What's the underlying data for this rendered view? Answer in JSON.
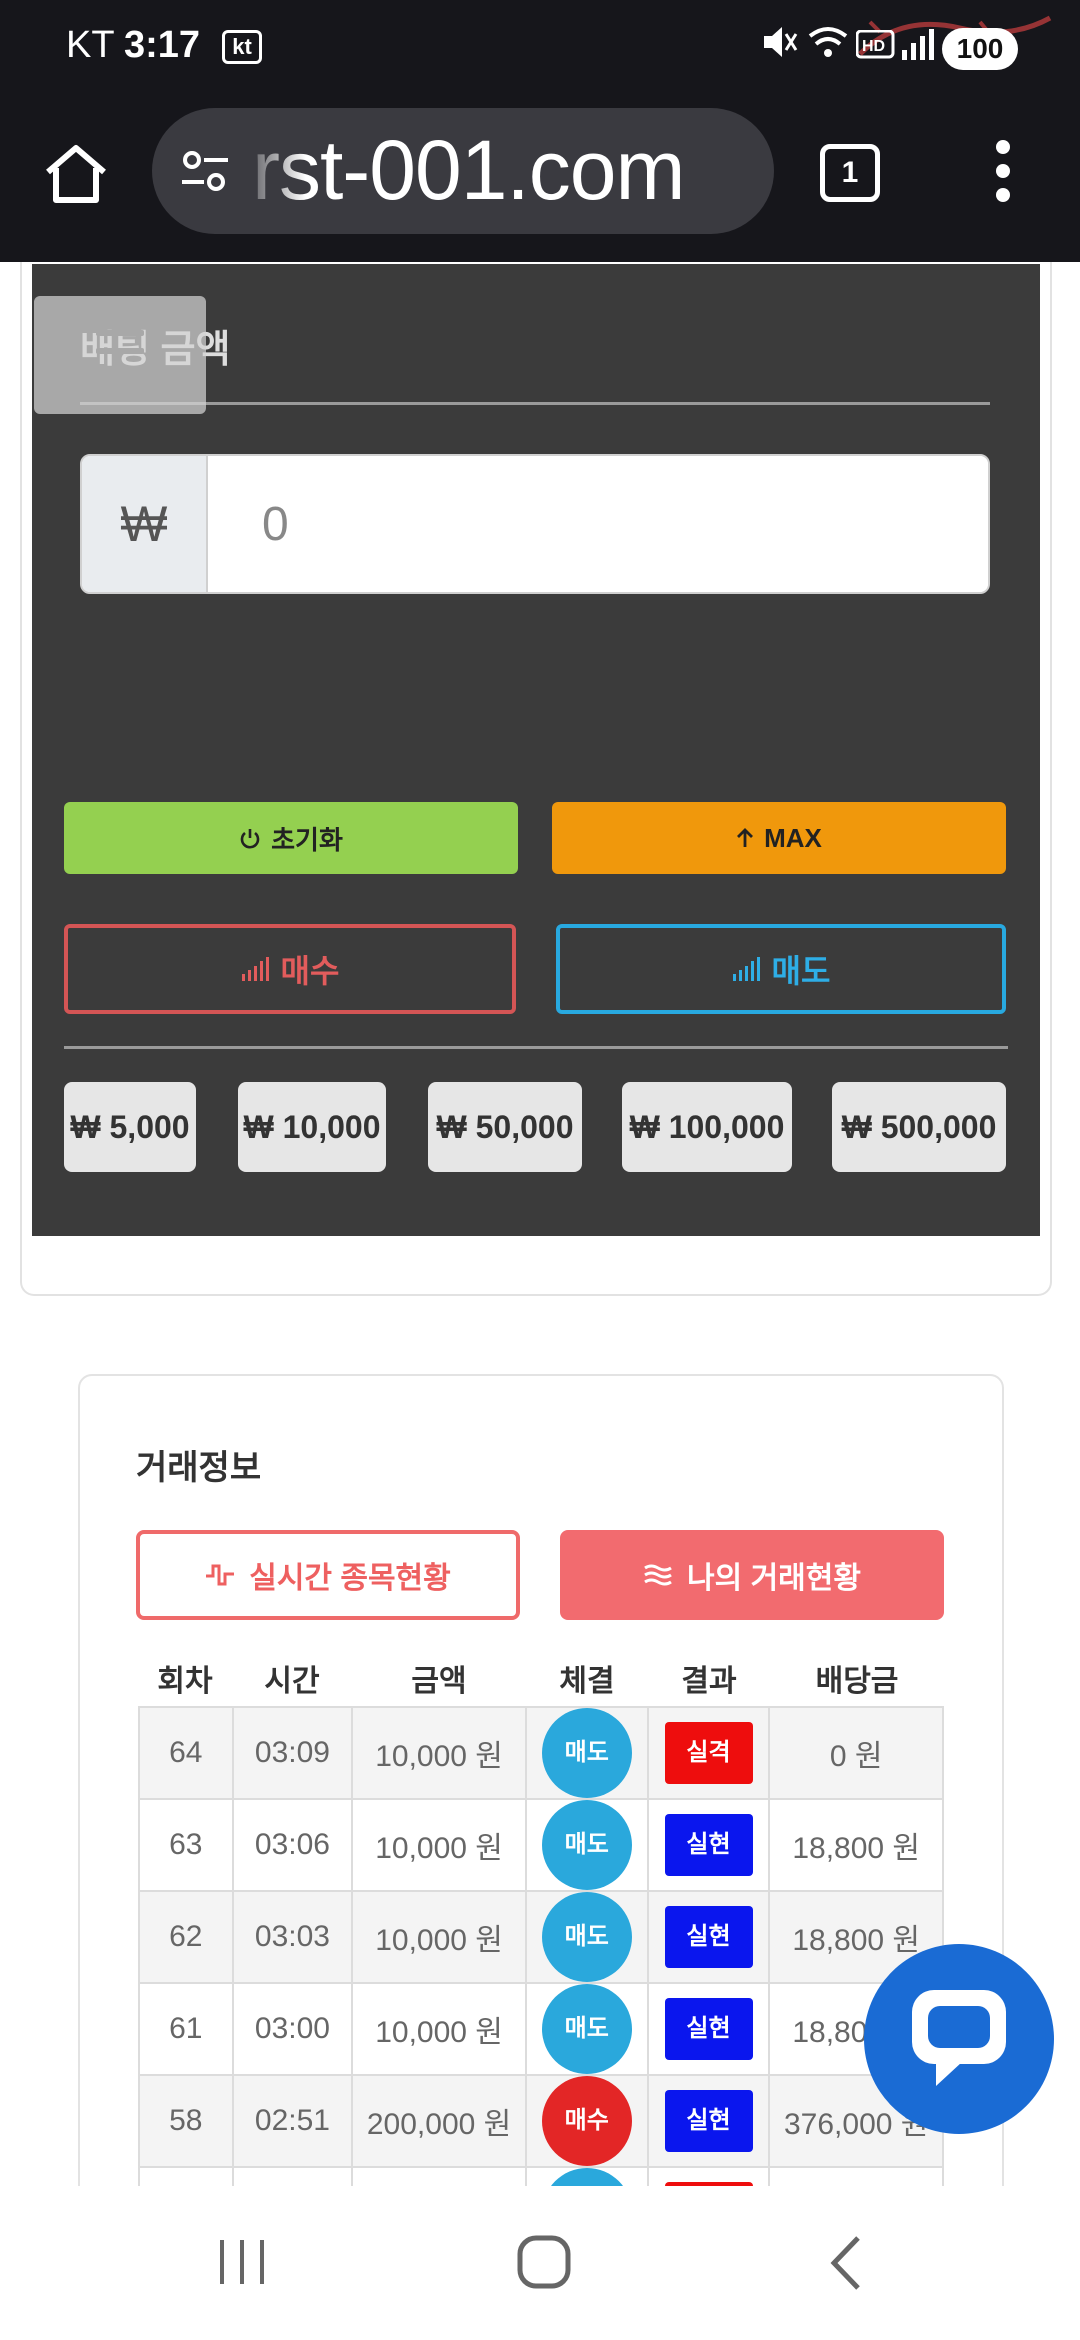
{
  "status_bar": {
    "carrier": "KT",
    "time": "3:17",
    "carrier_badge": "kt",
    "battery": "100",
    "icons": [
      "mute-icon",
      "wifi-icon",
      "hd-voice-icon",
      "signal-icon"
    ]
  },
  "browser": {
    "url": "rst-001.com",
    "tab_count": "1"
  },
  "bet_panel": {
    "title": "배팅 금액",
    "currency_symbol": "₩",
    "amount_placeholder": "0",
    "reset_label": "초기화",
    "max_label": "MAX",
    "buy_label": "매수",
    "sell_label": "매도",
    "chips": [
      "₩ 5,000",
      "₩ 10,000",
      "₩ 50,000",
      "₩ 100,000",
      "₩ 500,000"
    ]
  },
  "trade": {
    "title": "거래정보",
    "tab_live": "실시간 종목현황",
    "tab_mine": "나의 거래현황",
    "columns": [
      "회차",
      "시간",
      "금액",
      "체결",
      "결과",
      "배당금"
    ],
    "rows": [
      {
        "round": "64",
        "time": "03:09",
        "amount": "10,000 원",
        "side": "매도",
        "result": "실격",
        "payout": "0 원"
      },
      {
        "round": "63",
        "time": "03:06",
        "amount": "10,000 원",
        "side": "매도",
        "result": "실현",
        "payout": "18,800 원"
      },
      {
        "round": "62",
        "time": "03:03",
        "amount": "10,000 원",
        "side": "매도",
        "result": "실현",
        "payout": "18,800 원"
      },
      {
        "round": "61",
        "time": "03:00",
        "amount": "10,000 원",
        "side": "매도",
        "result": "실현",
        "payout": "18,800 원"
      },
      {
        "round": "58",
        "time": "02:51",
        "amount": "200,000 원",
        "side": "매수",
        "result": "실현",
        "payout": "376,000 원"
      }
    ]
  },
  "colors": {
    "panel_bg": "#3b3b3b",
    "reset_green": "#94d050",
    "max_orange": "#f0980c",
    "buy_red": "#d45555",
    "sell_blue": "#28a9e0",
    "tab_red": "#f26b6f",
    "result_lose": "#ee0d0d",
    "result_win": "#0a16ee",
    "chat_blue": "#1a6bd4"
  }
}
